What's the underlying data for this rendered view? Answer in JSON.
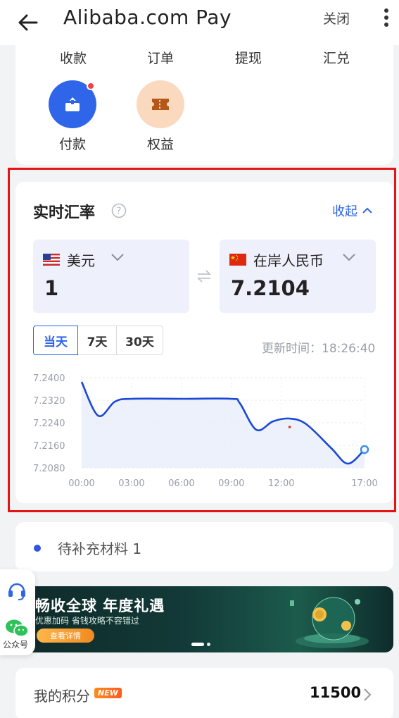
{
  "header": {
    "title": "Alibaba.com Pay",
    "close_label": "关闭"
  },
  "shortcuts": {
    "top_row": [
      "收款",
      "订单",
      "提现",
      "汇兑"
    ],
    "items": [
      {
        "label": "付款",
        "icon": "payment-icon",
        "has_dot": true,
        "color": "#2f65e8"
      },
      {
        "label": "权益",
        "icon": "ticket-icon",
        "color": "#fbd9bf"
      }
    ]
  },
  "rate": {
    "title": "实时汇率",
    "collapse_label": "收起",
    "from_currency": {
      "name": "美元",
      "flag": "us-flag-icon",
      "value": "1"
    },
    "to_currency": {
      "name": "在岸人民币",
      "flag": "cn-flag-icon",
      "value": "7.2104"
    },
    "ranges": [
      "当天",
      "7天",
      "30天"
    ],
    "active_range": "当天",
    "update_time": "更新时间：18:26:40"
  },
  "chart_data": {
    "type": "line",
    "x_ticks": [
      "00:00",
      "03:00",
      "06:00",
      "09:00",
      "12:00",
      "17:00"
    ],
    "y_ticks": [
      "7.2400",
      "7.2320",
      "7.2240",
      "7.2160",
      "7.2080"
    ],
    "ylim": [
      7.208,
      7.24
    ],
    "x": [
      "00:00",
      "01:00",
      "02:00",
      "03:00",
      "06:00",
      "09:00",
      "09:30",
      "10:30",
      "11:30",
      "12:30",
      "13:30",
      "15:00",
      "16:00",
      "17:00"
    ],
    "values": [
      7.2385,
      7.2265,
      7.2315,
      7.2325,
      7.2325,
      7.2325,
      7.231,
      7.2215,
      7.2245,
      7.2255,
      7.2235,
      7.215,
      7.2095,
      7.2145
    ],
    "marker": {
      "x": "12:30",
      "value": 7.2225
    },
    "colors": {
      "line": "#1a48d6",
      "fill": "#e9eefb",
      "marker": "#e02a2a"
    }
  },
  "pending": {
    "text": "待补充材料 1"
  },
  "float_side": {
    "service_icon": "headset-icon",
    "wechat_icon": "wechat-icon",
    "wechat_label": "公众号"
  },
  "banner": {
    "title": "畅收全球 年度礼遇",
    "subtitle": "优惠加码 省钱攻略不容错过",
    "button": "查看详情"
  },
  "points": {
    "label": "我的积分",
    "badge": "NEW",
    "value": "11500"
  },
  "colors": {
    "accent": "#2f65e8",
    "highlight": "#e31515"
  }
}
